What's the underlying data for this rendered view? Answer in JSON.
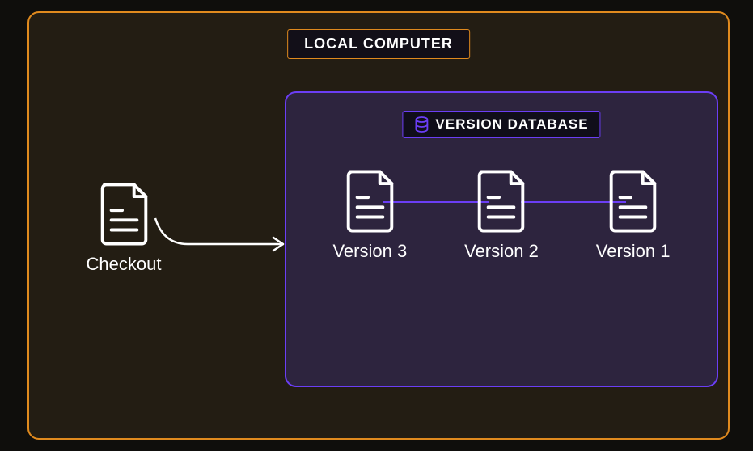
{
  "diagram": {
    "outer_label": "LOCAL COMPUTER",
    "checkout_label": "Checkout",
    "version_db_label": "VERSION DATABASE",
    "versions": {
      "v3": "Version 3",
      "v2": "Version 2",
      "v1": "Version 1"
    },
    "colors": {
      "outer_border": "#e08a1e",
      "inner_border": "#6b3ef5",
      "bg": "#0f0e0c"
    }
  }
}
